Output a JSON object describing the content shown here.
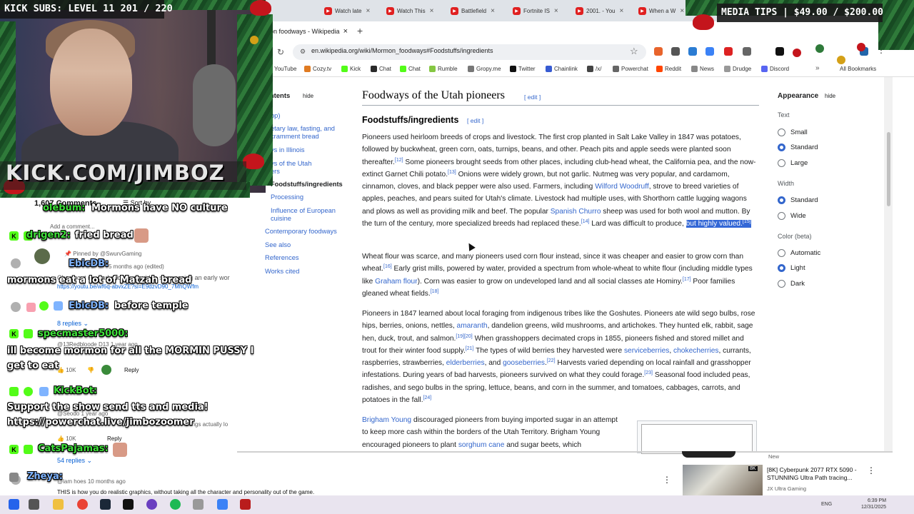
{
  "overlay": {
    "kick_subs": "KICK SUBS: LEVEL 11 201 / 220",
    "media_tips": "MEDIA TIPS | $49.00 / $200.00",
    "kick_url": "KICK.COM/JIMBOZ"
  },
  "browser": {
    "tabs": [
      {
        "label": "Watch late"
      },
      {
        "label": "Watch This"
      },
      {
        "label": "Battlefield"
      },
      {
        "label": "Fortnite IS"
      },
      {
        "label": "2001. - You"
      },
      {
        "label": "When a W"
      }
    ],
    "active_tab": "on foodways - Wikipedia",
    "url": "en.wikipedia.org/wiki/Mormon_foodways#Foodstuffs/ingredients",
    "bookmarks": [
      "YouTube",
      "Cozy.tv",
      "Kick",
      "Chat",
      "Chat",
      "Rumble",
      "Gropy.me",
      "Twitter",
      "Chainlink",
      "/x/",
      "Powerchat",
      "Reddit",
      "News",
      "Drudge",
      "Discord"
    ],
    "all_bookmarks": "All Bookmarks",
    "corner_text": "arks"
  },
  "wiki": {
    "toc_heading": "ontents",
    "toc_hide": "hide",
    "toc_items": [
      "op)",
      "etary law, fasting, and",
      "cramment bread",
      "ys in Illinois",
      "ys of the Utah",
      "ers",
      "Foodstuffs/ingredients",
      "Processing",
      "Influence of European",
      "cuisine",
      "Contemporary foodways",
      "See also",
      "References",
      "Works cited"
    ],
    "h2": "Foodways of the Utah pioneers",
    "h3": "Foodstuffs/ingredients",
    "edit": "edit",
    "p1_a": "Pioneers used heirloom breeds of crops and livestock. The first crop planted in Salt Lake Valley in 1847 was potatoes, followed by buckwheat, green corn, oats, turnips, beans, and other. Peach pits and apple seeds were planted soon thereafter.",
    "p1_b": "Some pioneers brought seeds from other places, including club-head wheat, the California pea, and the now-extinct Garnet Chili potato.",
    "p1_c": "Onions were widely grown, but not garlic. Nutmeg was very popular, and cardamom, cinnamon, cloves, and black pepper were also used. Farmers, including",
    "p1_link1": "Wilford Woodruff",
    "p1_d": ", strove to breed varieties of apples, peaches, and pears suited for Utah's climate. Livestock had multiple uses, with Shorthorn cattle lugging wagons and plows as well as providing milk and beef. The popular",
    "p1_link2": "Spanish Churro",
    "p1_e": "sheep was used for both wool and mutton. By the turn of the century, more specialized breeds had replaced these.",
    "p1_f": "Lard was difficult to produce,",
    "p1_hl": "but highly valued.",
    "p2_a": "Wheat flour was scarce, and many pioneers used corn flour instead, since it was cheaper and easier to grow corn than wheat.",
    "p2_b": "Early grist mills, powered by water, provided a spectrum from whole-wheat to white flour (including middle types like",
    "p2_link": "Graham flour",
    "p2_c": "). Corn was easier to grow on undeveloped land and all social classes ate Hominy.",
    "p2_d": "Poor families gleaned wheat fields.",
    "p3_a": "Pioneers in 1847 learned about local foraging from indigenous tribes like the Goshutes. Pioneers ate wild sego bulbs, rose hips, berries, onions, nettles,",
    "p3_l1": "amaranth",
    "p3_b": ", dandelion greens, wild mushrooms, and artichokes. They hunted elk, rabbit, sage hen, duck, trout, and salmon.",
    "p3_c": "When grasshoppers decimated crops in 1855, pioneers fished and stored millet and trout for their winter food supply.",
    "p3_d": "The types of wild berries they harvested were",
    "p3_l2": "serviceberries",
    "p3_l3": "chokecherries",
    "p3_e": ", currants, raspberries, strawberries,",
    "p3_l4": "elderberries",
    "p3_f": ", and",
    "p3_l5": "gooseberries",
    "p3_g": "Harvests varied depending on local rainfall and grasshopper infestations. During years of bad harvests, pioneers survived on what they could forage.",
    "p3_h": "Seasonal food included peas, radishes, and sego bulbs in the spring, lettuce, beans, and corn in the summer, and tomatoes, cabbages, carrots, and potatoes in the fall.",
    "p4_l": "Brigham Young",
    "p4_a": "discouraged pioneers from buying imported sugar in an attempt to keep more cash within the borders of the Utah Territory. Brigham Young encouraged pioneers to plant",
    "p4_l2": "sorghum cane",
    "p4_b": "and sugar beets, which",
    "refs": {
      "r12": "[12]",
      "r13": "[13]",
      "r14": "[14]",
      "r15": "[15]",
      "r16": "[16]",
      "r17": "[17]",
      "r18": "[18]",
      "r1920": "[19][20]",
      "r21": "[21]",
      "r22": "[22]",
      "r23": "[23]",
      "r24": "[24]"
    },
    "appearance": {
      "title": "Appearance",
      "hide": "hide",
      "text_label": "Text",
      "text_opts": [
        "Small",
        "Standard",
        "Large"
      ],
      "width_label": "Width",
      "width_opts": [
        "Standard",
        "Wide"
      ],
      "color_label": "Color (beta)",
      "color_opts": [
        "Automatic",
        "Light",
        "Dark"
      ]
    }
  },
  "youtube": {
    "comments_count": "1,607 Comments",
    "sort_by": "Sort by",
    "add_comment": "Add a comment...",
    "pinned": "Pinned by @SwurvGaming",
    "pinned_time": "5 months ago (edited)",
    "pinned_text": "Check out my early hopmunk video showcasing an early wor",
    "pinned_link": "https://youtu.be/wf6q-abvxZE?si=E9dzvD90_7MhQWfm",
    "replies1": "8 replies",
    "user2": "@13Redbloode D13",
    "time2": "1 year ago",
    "likes": "10K",
    "reply": "Reply",
    "user3": "@Seodo",
    "time3": "1 year ago",
    "text3": "things actually lo",
    "replies2": "54 replies",
    "user4": "@lam",
    "user4b": "hoes",
    "time4": "10 months ago",
    "text4": "THIS is how you do realistic graphics, without taking all the character and personality out of the game."
  },
  "chat": [
    {
      "name": "olebum:",
      "msg": "Mormons have NO culture"
    },
    {
      "name": "drigen2:",
      "msg": "fried bread"
    },
    {
      "name": "EbicDB:",
      "msg": ""
    },
    {
      "name": "",
      "msg": "mormons eat a lot of Matzah bread"
    },
    {
      "name": "EbicDB:",
      "msg": "before temple"
    },
    {
      "name": "specmaster5000:",
      "msg": ""
    },
    {
      "name": "",
      "msg": "ill become mormon for all the MORMIN PUSSY I"
    },
    {
      "name": "",
      "msg": "get to eat"
    },
    {
      "name": "KickBot:",
      "msg": ""
    },
    {
      "name": "",
      "msg": "Support the show send tts and media!"
    },
    {
      "name": "",
      "msg": "https://powerchat.live/jimbozoomer"
    },
    {
      "name": "CatsPajamas:",
      "msg": ""
    },
    {
      "name": "Zheya:",
      "msg": ""
    }
  ],
  "recommendation": {
    "badge_new": "New",
    "title": "[8K] Cyberpunk 2077 RTX 5090 - STUNNING Ultra Path tracing...",
    "channel": "JX Ultra Gaming",
    "tag": "8K"
  },
  "taskbar": {
    "lang": "ENG",
    "time": "6:39 PM",
    "date": "12/31/2025"
  },
  "colors": {
    "link": "#3366cc",
    "highlight": "#3367d6",
    "kick_green": "#53fc18"
  }
}
